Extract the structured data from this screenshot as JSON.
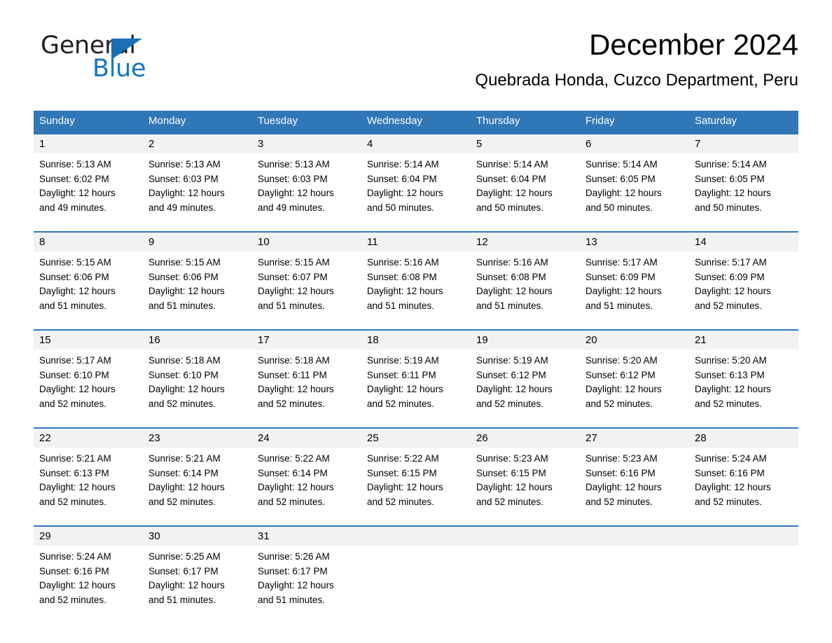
{
  "brand": {
    "name_part1": "General",
    "name_part2": "Blue",
    "triangle_color": "#1b6fb5",
    "blue_text_color": "#1277c4"
  },
  "header": {
    "title": "December 2024",
    "subtitle": "Quebrada Honda, Cuzco Department, Peru"
  },
  "theme": {
    "header_blue": "#3077b8",
    "daynum_gray": "#f2f2f2",
    "separator_blue": "#3077b8"
  },
  "weekdays": [
    "Sunday",
    "Monday",
    "Tuesday",
    "Wednesday",
    "Thursday",
    "Friday",
    "Saturday"
  ],
  "labels": {
    "sunrise_prefix": "Sunrise:",
    "sunset_prefix": "Sunset:",
    "daylight_prefix": "Daylight:"
  },
  "weeks": [
    [
      {
        "day": "1",
        "sunrise": "Sunrise: 5:13 AM",
        "sunset": "Sunset: 6:02 PM",
        "daylight_line1": "Daylight: 12 hours",
        "daylight_line2": "and 49 minutes."
      },
      {
        "day": "2",
        "sunrise": "Sunrise: 5:13 AM",
        "sunset": "Sunset: 6:03 PM",
        "daylight_line1": "Daylight: 12 hours",
        "daylight_line2": "and 49 minutes."
      },
      {
        "day": "3",
        "sunrise": "Sunrise: 5:13 AM",
        "sunset": "Sunset: 6:03 PM",
        "daylight_line1": "Daylight: 12 hours",
        "daylight_line2": "and 49 minutes."
      },
      {
        "day": "4",
        "sunrise": "Sunrise: 5:14 AM",
        "sunset": "Sunset: 6:04 PM",
        "daylight_line1": "Daylight: 12 hours",
        "daylight_line2": "and 50 minutes."
      },
      {
        "day": "5",
        "sunrise": "Sunrise: 5:14 AM",
        "sunset": "Sunset: 6:04 PM",
        "daylight_line1": "Daylight: 12 hours",
        "daylight_line2": "and 50 minutes."
      },
      {
        "day": "6",
        "sunrise": "Sunrise: 5:14 AM",
        "sunset": "Sunset: 6:05 PM",
        "daylight_line1": "Daylight: 12 hours",
        "daylight_line2": "and 50 minutes."
      },
      {
        "day": "7",
        "sunrise": "Sunrise: 5:14 AM",
        "sunset": "Sunset: 6:05 PM",
        "daylight_line1": "Daylight: 12 hours",
        "daylight_line2": "and 50 minutes."
      }
    ],
    [
      {
        "day": "8",
        "sunrise": "Sunrise: 5:15 AM",
        "sunset": "Sunset: 6:06 PM",
        "daylight_line1": "Daylight: 12 hours",
        "daylight_line2": "and 51 minutes."
      },
      {
        "day": "9",
        "sunrise": "Sunrise: 5:15 AM",
        "sunset": "Sunset: 6:06 PM",
        "daylight_line1": "Daylight: 12 hours",
        "daylight_line2": "and 51 minutes."
      },
      {
        "day": "10",
        "sunrise": "Sunrise: 5:15 AM",
        "sunset": "Sunset: 6:07 PM",
        "daylight_line1": "Daylight: 12 hours",
        "daylight_line2": "and 51 minutes."
      },
      {
        "day": "11",
        "sunrise": "Sunrise: 5:16 AM",
        "sunset": "Sunset: 6:08 PM",
        "daylight_line1": "Daylight: 12 hours",
        "daylight_line2": "and 51 minutes."
      },
      {
        "day": "12",
        "sunrise": "Sunrise: 5:16 AM",
        "sunset": "Sunset: 6:08 PM",
        "daylight_line1": "Daylight: 12 hours",
        "daylight_line2": "and 51 minutes."
      },
      {
        "day": "13",
        "sunrise": "Sunrise: 5:17 AM",
        "sunset": "Sunset: 6:09 PM",
        "daylight_line1": "Daylight: 12 hours",
        "daylight_line2": "and 51 minutes."
      },
      {
        "day": "14",
        "sunrise": "Sunrise: 5:17 AM",
        "sunset": "Sunset: 6:09 PM",
        "daylight_line1": "Daylight: 12 hours",
        "daylight_line2": "and 52 minutes."
      }
    ],
    [
      {
        "day": "15",
        "sunrise": "Sunrise: 5:17 AM",
        "sunset": "Sunset: 6:10 PM",
        "daylight_line1": "Daylight: 12 hours",
        "daylight_line2": "and 52 minutes."
      },
      {
        "day": "16",
        "sunrise": "Sunrise: 5:18 AM",
        "sunset": "Sunset: 6:10 PM",
        "daylight_line1": "Daylight: 12 hours",
        "daylight_line2": "and 52 minutes."
      },
      {
        "day": "17",
        "sunrise": "Sunrise: 5:18 AM",
        "sunset": "Sunset: 6:11 PM",
        "daylight_line1": "Daylight: 12 hours",
        "daylight_line2": "and 52 minutes."
      },
      {
        "day": "18",
        "sunrise": "Sunrise: 5:19 AM",
        "sunset": "Sunset: 6:11 PM",
        "daylight_line1": "Daylight: 12 hours",
        "daylight_line2": "and 52 minutes."
      },
      {
        "day": "19",
        "sunrise": "Sunrise: 5:19 AM",
        "sunset": "Sunset: 6:12 PM",
        "daylight_line1": "Daylight: 12 hours",
        "daylight_line2": "and 52 minutes."
      },
      {
        "day": "20",
        "sunrise": "Sunrise: 5:20 AM",
        "sunset": "Sunset: 6:12 PM",
        "daylight_line1": "Daylight: 12 hours",
        "daylight_line2": "and 52 minutes."
      },
      {
        "day": "21",
        "sunrise": "Sunrise: 5:20 AM",
        "sunset": "Sunset: 6:13 PM",
        "daylight_line1": "Daylight: 12 hours",
        "daylight_line2": "and 52 minutes."
      }
    ],
    [
      {
        "day": "22",
        "sunrise": "Sunrise: 5:21 AM",
        "sunset": "Sunset: 6:13 PM",
        "daylight_line1": "Daylight: 12 hours",
        "daylight_line2": "and 52 minutes."
      },
      {
        "day": "23",
        "sunrise": "Sunrise: 5:21 AM",
        "sunset": "Sunset: 6:14 PM",
        "daylight_line1": "Daylight: 12 hours",
        "daylight_line2": "and 52 minutes."
      },
      {
        "day": "24",
        "sunrise": "Sunrise: 5:22 AM",
        "sunset": "Sunset: 6:14 PM",
        "daylight_line1": "Daylight: 12 hours",
        "daylight_line2": "and 52 minutes."
      },
      {
        "day": "25",
        "sunrise": "Sunrise: 5:22 AM",
        "sunset": "Sunset: 6:15 PM",
        "daylight_line1": "Daylight: 12 hours",
        "daylight_line2": "and 52 minutes."
      },
      {
        "day": "26",
        "sunrise": "Sunrise: 5:23 AM",
        "sunset": "Sunset: 6:15 PM",
        "daylight_line1": "Daylight: 12 hours",
        "daylight_line2": "and 52 minutes."
      },
      {
        "day": "27",
        "sunrise": "Sunrise: 5:23 AM",
        "sunset": "Sunset: 6:16 PM",
        "daylight_line1": "Daylight: 12 hours",
        "daylight_line2": "and 52 minutes."
      },
      {
        "day": "28",
        "sunrise": "Sunrise: 5:24 AM",
        "sunset": "Sunset: 6:16 PM",
        "daylight_line1": "Daylight: 12 hours",
        "daylight_line2": "and 52 minutes."
      }
    ],
    [
      {
        "day": "29",
        "sunrise": "Sunrise: 5:24 AM",
        "sunset": "Sunset: 6:16 PM",
        "daylight_line1": "Daylight: 12 hours",
        "daylight_line2": "and 52 minutes."
      },
      {
        "day": "30",
        "sunrise": "Sunrise: 5:25 AM",
        "sunset": "Sunset: 6:17 PM",
        "daylight_line1": "Daylight: 12 hours",
        "daylight_line2": "and 51 minutes."
      },
      {
        "day": "31",
        "sunrise": "Sunrise: 5:26 AM",
        "sunset": "Sunset: 6:17 PM",
        "daylight_line1": "Daylight: 12 hours",
        "daylight_line2": "and 51 minutes."
      },
      {
        "day": "",
        "sunrise": "",
        "sunset": "",
        "daylight_line1": "",
        "daylight_line2": ""
      },
      {
        "day": "",
        "sunrise": "",
        "sunset": "",
        "daylight_line1": "",
        "daylight_line2": ""
      },
      {
        "day": "",
        "sunrise": "",
        "sunset": "",
        "daylight_line1": "",
        "daylight_line2": ""
      },
      {
        "day": "",
        "sunrise": "",
        "sunset": "",
        "daylight_line1": "",
        "daylight_line2": ""
      }
    ]
  ]
}
